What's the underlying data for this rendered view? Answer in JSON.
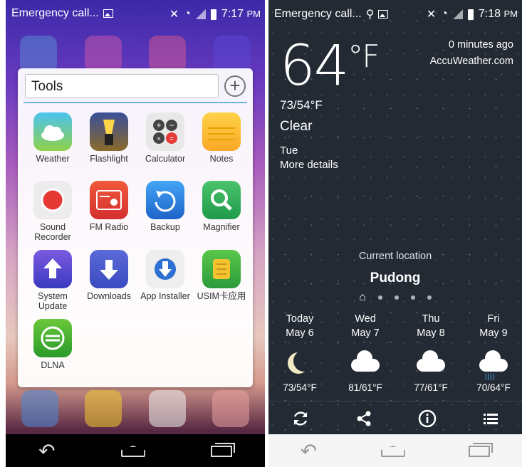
{
  "left": {
    "status": {
      "notification": "Emergency call...",
      "time": "7:17",
      "ampm": "PM"
    },
    "folder": {
      "name": "Tools",
      "apps": [
        {
          "label": "Weather"
        },
        {
          "label": "Flashlight"
        },
        {
          "label": "Calculator"
        },
        {
          "label": "Notes"
        },
        {
          "label": "Sound Recorder"
        },
        {
          "label": "FM Radio"
        },
        {
          "label": "Backup"
        },
        {
          "label": "Magnifier"
        },
        {
          "label": "System Update"
        },
        {
          "label": "Downloads"
        },
        {
          "label": "App Installer"
        },
        {
          "label": "USIM卡应用"
        },
        {
          "label": "DLNA"
        }
      ]
    }
  },
  "right": {
    "status": {
      "notification": "Emergency call...",
      "time": "7:18",
      "ampm": "PM"
    },
    "weather": {
      "temp": "64",
      "unit": "°F",
      "updated": "0 minutes ago",
      "source": "AccuWeather.com",
      "hilo": "73/54°F",
      "condition": "Clear",
      "day": "Tue",
      "more": "More details",
      "location_label": "Current location",
      "location_name": "Pudong",
      "forecast": [
        {
          "day": "Today",
          "date": "May 6",
          "temps": "73/54°F",
          "icon": "moon-icon"
        },
        {
          "day": "Wed",
          "date": "May 7",
          "temps": "81/61°F",
          "icon": "cloud-icon"
        },
        {
          "day": "Thu",
          "date": "May 8",
          "temps": "77/61°F",
          "icon": "cloud-icon"
        },
        {
          "day": "Fri",
          "date": "May 9",
          "temps": "70/64°F",
          "icon": "rain-cloud-icon"
        }
      ]
    }
  },
  "colors": {
    "folder_accent": "#68b5e6",
    "weather_bg": "#232a34"
  }
}
